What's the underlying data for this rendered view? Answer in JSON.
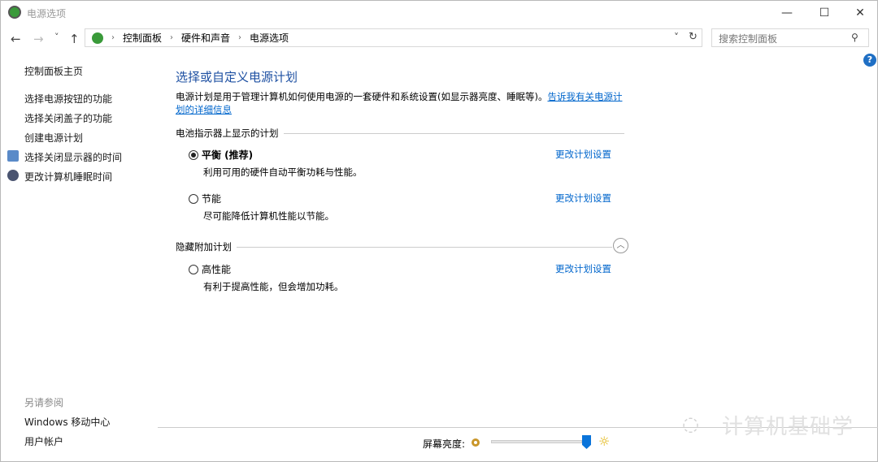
{
  "window": {
    "title": "电源选项",
    "controls": [
      "—",
      "☐",
      "✕"
    ]
  },
  "nav": {
    "back": "←",
    "forward": "→",
    "recent": "˅",
    "up": "↑",
    "refresh": "↻",
    "dropdown": "˅"
  },
  "breadcrumb": [
    "控制面板",
    "硬件和声音",
    "电源选项"
  ],
  "search": {
    "placeholder": "搜索控制面板",
    "icon": "search-icon"
  },
  "help": "?",
  "sidebar": {
    "items": [
      {
        "label": "控制面板主页"
      },
      {
        "label": "选择电源按钮的功能"
      },
      {
        "label": "选择关闭盖子的功能"
      },
      {
        "label": "创建电源计划"
      },
      {
        "label": "选择关闭显示器的时间"
      },
      {
        "label": "更改计算机睡眠时间"
      }
    ],
    "see_also": "另请参阅",
    "links": [
      "Windows 移动中心",
      "用户帐户"
    ]
  },
  "main": {
    "title": "选择或自定义电源计划",
    "desc": "电源计划是用于管理计算机如何使用电源的一套硬件和系统设置(如显示器亮度、睡眠等)。",
    "desc_link": "告诉我有关电源计划的详细信息",
    "section1": "电池指示器上显示的计划",
    "section2": "隐藏附加计划",
    "plans": [
      {
        "name": "平衡 (推荐)",
        "desc": "利用可用的硬件自动平衡功耗与性能。",
        "selected": true,
        "change": "更改计划设置"
      },
      {
        "name": "节能",
        "desc": "尽可能降低计算机性能以节能。",
        "selected": false,
        "change": "更改计划设置"
      },
      {
        "name": "高性能",
        "desc": "有利于提高性能，但会增加功耗。",
        "selected": false,
        "change": "更改计划设置"
      }
    ]
  },
  "brightness": {
    "label": "屏幕亮度:",
    "value_percent": 100
  },
  "watermark": "计算机基础学",
  "colors": {
    "accent": "#0066cc",
    "title": "#1e50a2",
    "slider": "#0a74da"
  }
}
